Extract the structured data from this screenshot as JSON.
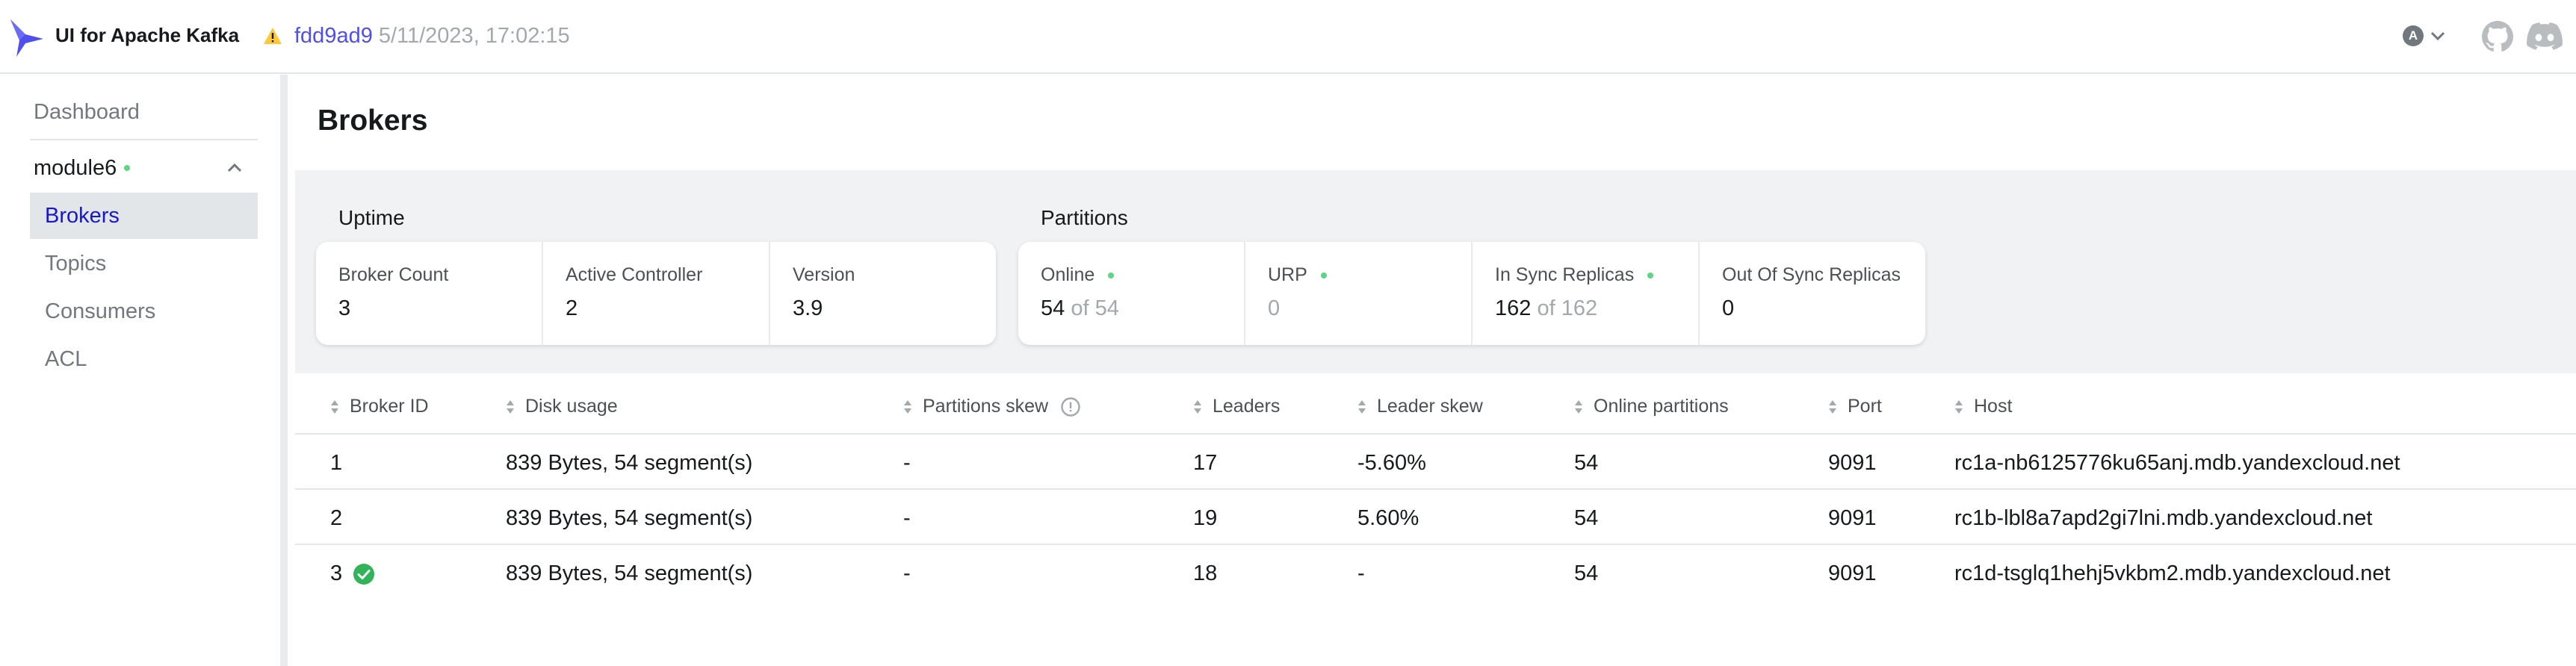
{
  "navbar": {
    "title": "UI for Apache Kafka",
    "commit": "fdd9ad9",
    "build_date": "5/11/2023, 17:02:15",
    "theme_letter": "A"
  },
  "sidebar": {
    "dashboard": "Dashboard",
    "cluster": "module6",
    "items": [
      {
        "label": "Brokers",
        "active": true
      },
      {
        "label": "Topics",
        "active": false
      },
      {
        "label": "Consumers",
        "active": false
      },
      {
        "label": "ACL",
        "active": false
      }
    ]
  },
  "page": {
    "title": "Brokers"
  },
  "metrics": {
    "uptime": {
      "title": "Uptime",
      "broker_count_label": "Broker Count",
      "broker_count_value": "3",
      "active_controller_label": "Active Controller",
      "active_controller_value": "2",
      "version_label": "Version",
      "version_value": "3.9"
    },
    "partitions": {
      "title": "Partitions",
      "online_label": "Online",
      "online_value": "54",
      "online_total": "of 54",
      "urp_label": "URP",
      "urp_value": "0",
      "in_sync_label": "In Sync Replicas",
      "in_sync_value": "162",
      "in_sync_total": "of 162",
      "out_of_sync_label": "Out Of Sync Replicas",
      "out_of_sync_value": "0"
    }
  },
  "table": {
    "headers": {
      "broker_id": "Broker ID",
      "disk_usage": "Disk usage",
      "partitions_skew": "Partitions skew",
      "leaders": "Leaders",
      "leader_skew": "Leader skew",
      "online_partitions": "Online partitions",
      "port": "Port",
      "host": "Host"
    },
    "rows": [
      {
        "broker_id": "1",
        "disk_usage": "839 Bytes, 54 segment(s)",
        "partitions_skew": "-",
        "leaders": "17",
        "leader_skew": "-5.60%",
        "online_partitions": "54",
        "port": "9091",
        "host": "rc1a-nb6125776ku65anj.mdb.yandexcloud.net",
        "controller": false
      },
      {
        "broker_id": "2",
        "disk_usage": "839 Bytes, 54 segment(s)",
        "partitions_skew": "-",
        "leaders": "19",
        "leader_skew": "5.60%",
        "online_partitions": "54",
        "port": "9091",
        "host": "rc1b-lbl8a7apd2gi7lni.mdb.yandexcloud.net",
        "controller": false
      },
      {
        "broker_id": "3",
        "disk_usage": "839 Bytes, 54 segment(s)",
        "partitions_skew": "-",
        "leaders": "18",
        "leader_skew": "-",
        "online_partitions": "54",
        "port": "9091",
        "host": "rc1d-tsglq1hehj5vkbm2.mdb.yandexcloud.net",
        "controller": true
      }
    ]
  },
  "colors": {
    "accent": "#4f4ff0",
    "active_nav": "#1717cf",
    "status_green": "#5cd685",
    "controller_badge": "#2fb45a"
  },
  "icons": [
    "kafka-logo-icon",
    "warning-icon",
    "chevron-down-icon",
    "github-icon",
    "discord-icon",
    "chevron-up-icon",
    "sort-icon",
    "info-icon",
    "check-circle-icon"
  ]
}
